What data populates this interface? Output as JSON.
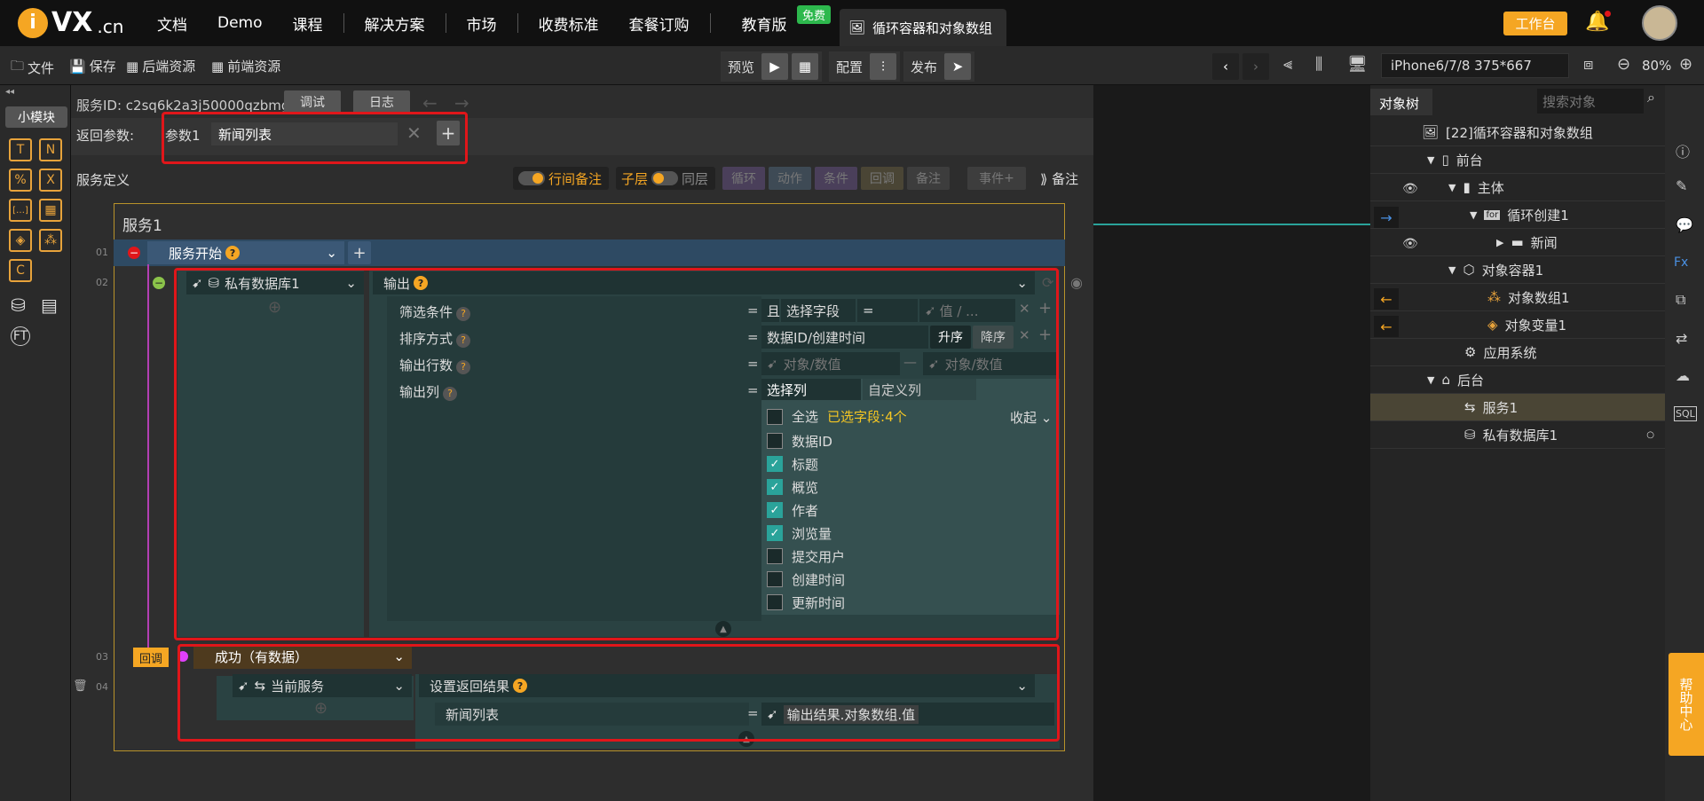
{
  "topbar": {
    "logo_text": "VX",
    "logo_suffix": ".cn",
    "nav": [
      "文档",
      "Demo",
      "课程",
      "解决方案",
      "市场",
      "收费标准",
      "套餐订购",
      "教育版"
    ],
    "free_badge": "免费",
    "active_tab": "循环容器和对象数组",
    "workbench": "工作台"
  },
  "toolbar": {
    "file": "文件",
    "save": "保存",
    "backend_res": "后端资源",
    "frontend_res": "前端资源",
    "preview": "预览",
    "config": "配置",
    "publish": "发布",
    "device": "iPhone6/7/8 375*667",
    "zoom": "80%"
  },
  "left": {
    "module_btn": "小模块",
    "icons": [
      "T",
      "N",
      "%",
      "X",
      "[…]",
      "grid",
      "obj",
      "objs",
      "C",
      "db",
      "table",
      "FT"
    ]
  },
  "service": {
    "id_label": "服务ID: c2sq6k2a3j50000qzbmg",
    "debug": "调试",
    "log": "日志",
    "return_label": "返回参数:",
    "param_label": "参数1",
    "param_value": "新闻列表",
    "def_label": "服务定义",
    "row_note": "行间备注",
    "child": "子层",
    "same": "同层",
    "loop": "循环",
    "action": "动作",
    "condition": "条件",
    "callback_btn": "回调",
    "note": "备注",
    "event": "事件",
    "note_right": "备注"
  },
  "canvas": {
    "title": "服务1",
    "line_numbers": [
      "01",
      "02",
      "03",
      "04"
    ],
    "start": "服务开始",
    "db_node": "私有数据库1",
    "output": "输出",
    "filter_label": "筛选条件",
    "sort_label": "排序方式",
    "rows_label": "输出行数",
    "cols_label": "输出列",
    "and": "且",
    "select_field": "选择字段",
    "eq": "=",
    "value_ph": "值 / ...",
    "sort_field": "数据ID/创建时间",
    "asc": "升序",
    "desc": "降序",
    "obj_value": "对象/数值",
    "tab_select": "选择列",
    "tab_custom": "自定义列",
    "select_all": "全选",
    "selected_count": "已选字段:4个",
    "collapse": "收起",
    "columns": [
      {
        "name": "数据ID",
        "checked": false
      },
      {
        "name": "标题",
        "checked": true
      },
      {
        "name": "概览",
        "checked": true
      },
      {
        "name": "作者",
        "checked": true
      },
      {
        "name": "浏览量",
        "checked": true
      },
      {
        "name": "提交用户",
        "checked": false
      },
      {
        "name": "创建时间",
        "checked": false
      },
      {
        "name": "更新时间",
        "checked": false
      }
    ],
    "callback_tag": "回调",
    "success": "成功（有数据）",
    "current_service": "当前服务",
    "set_return": "设置返回结果",
    "news_list": "新闻列表",
    "output_value": "输出结果.对象数组.值"
  },
  "tree": {
    "tab": "对象树",
    "search_ph": "搜索对象",
    "items": [
      "[22]循环容器和对象数组",
      "前台",
      "主体",
      "循环创建1",
      "新闻",
      "对象容器1",
      "对象数组1",
      "对象变量1",
      "应用系统",
      "后台",
      "服务1",
      "私有数据库1"
    ]
  },
  "help": "帮助中心"
}
